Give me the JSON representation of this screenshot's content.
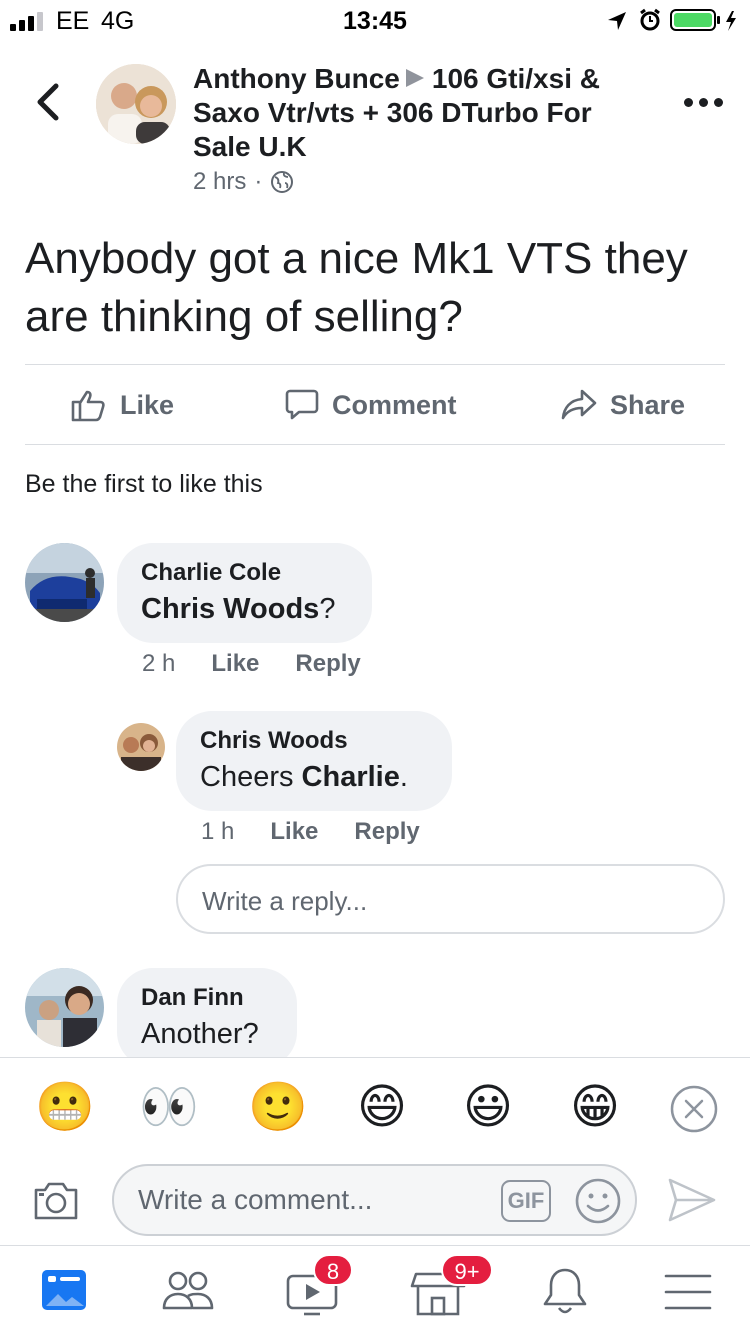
{
  "status_bar": {
    "carrier": "EE",
    "network": "4G",
    "time": "13:45"
  },
  "post": {
    "author": "Anthony Bunce",
    "group": "106 Gti/xsi & Saxo Vtr/vts + 306 DTurbo For Sale U.K",
    "time": "2 hrs",
    "text": "Anybody got a nice Mk1 VTS they are thinking of selling?"
  },
  "actions": {
    "like": "Like",
    "comment": "Comment",
    "share": "Share"
  },
  "likes_summary": "Be the first to like this",
  "comments": [
    {
      "name": "Charlie Cole",
      "mention": "Chris Woods",
      "suffix": "?",
      "time": "2 h",
      "like": "Like",
      "reply": "Reply"
    },
    {
      "name": "Chris Woods",
      "prefix": "Cheers ",
      "mention": "Charlie",
      "suffix": ".",
      "time": "1 h",
      "like": "Like",
      "reply": "Reply"
    },
    {
      "name": "Dan Finn",
      "text": "Another?"
    }
  ],
  "reply_placeholder": "Write a reply...",
  "comment_placeholder": "Write a comment...",
  "gif_label": "GIF",
  "emojis": [
    "😬",
    "👀",
    "🙂",
    "😄",
    "😃",
    "😁"
  ],
  "tabs": [
    {
      "icon": "news-feed-icon",
      "badge": ""
    },
    {
      "icon": "friends-icon",
      "badge": ""
    },
    {
      "icon": "watch-icon",
      "badge": "8"
    },
    {
      "icon": "marketplace-icon",
      "badge": "9+"
    },
    {
      "icon": "notifications-icon",
      "badge": ""
    },
    {
      "icon": "menu-icon",
      "badge": ""
    }
  ],
  "colors": {
    "accent": "#1877f2",
    "badge": "#e41e3f",
    "battery": "#4cd964"
  }
}
